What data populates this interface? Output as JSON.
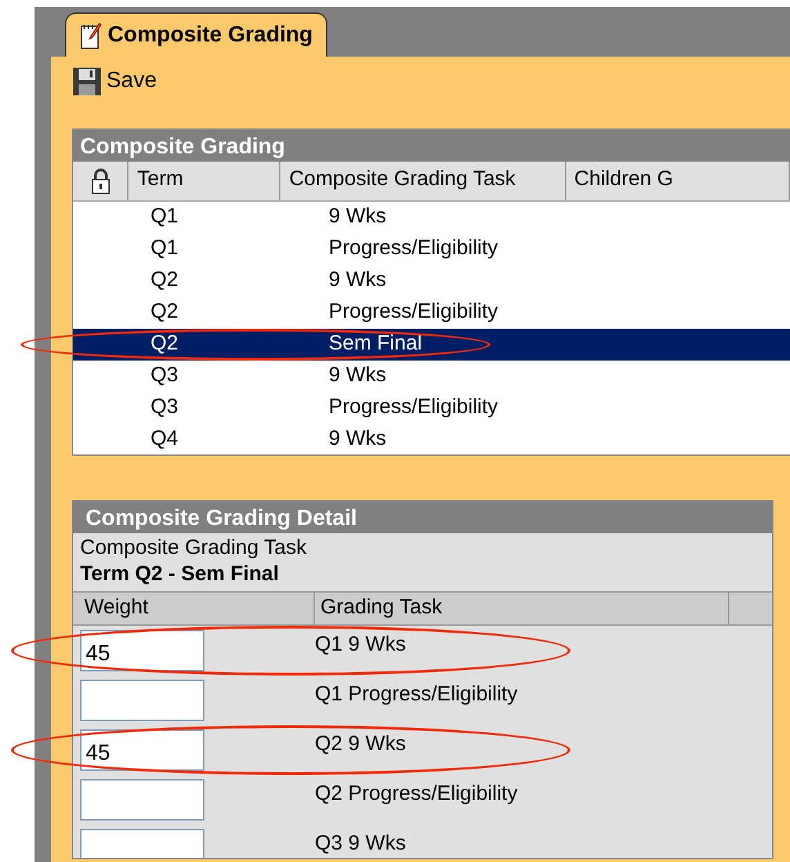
{
  "tab": {
    "label": "Composite Grading",
    "selected": true
  },
  "toolbar": {
    "save": "Save"
  },
  "grading_list": {
    "title": "Composite Grading",
    "columns": [
      "Term",
      "Composite Grading Task",
      "Children G"
    ],
    "rows": [
      {
        "term": "Q1",
        "task": "9 Wks",
        "selected": false,
        "circled": false
      },
      {
        "term": "Q1",
        "task": "Progress/Eligibility",
        "selected": false,
        "circled": false
      },
      {
        "term": "Q2",
        "task": "9 Wks",
        "selected": false,
        "circled": false
      },
      {
        "term": "Q2",
        "task": "Progress/Eligibility",
        "selected": false,
        "circled": false
      },
      {
        "term": "Q2",
        "task": "Sem Final",
        "selected": true,
        "circled": true
      },
      {
        "term": "Q3",
        "task": "9 Wks",
        "selected": false,
        "circled": false
      },
      {
        "term": "Q3",
        "task": "Progress/Eligibility",
        "selected": false,
        "circled": false
      },
      {
        "term": "Q4",
        "task": "9 Wks",
        "selected": false,
        "circled": false
      }
    ]
  },
  "detail": {
    "title": "Composite Grading Detail",
    "label": "Composite Grading Task",
    "heading": "Term Q2 - Sem Final",
    "columns": [
      "Weight",
      "Grading Task"
    ],
    "rows": [
      {
        "weight": "45",
        "task": "Q1 9 Wks",
        "circled": true
      },
      {
        "weight": "",
        "task": "Q1 Progress/Eligibility",
        "circled": false
      },
      {
        "weight": "45",
        "task": "Q2 9 Wks",
        "circled": true
      },
      {
        "weight": "",
        "task": "Q2 Progress/Eligibility",
        "circled": false
      },
      {
        "weight": "",
        "task": "Q3 9 Wks",
        "circled": false
      }
    ]
  }
}
